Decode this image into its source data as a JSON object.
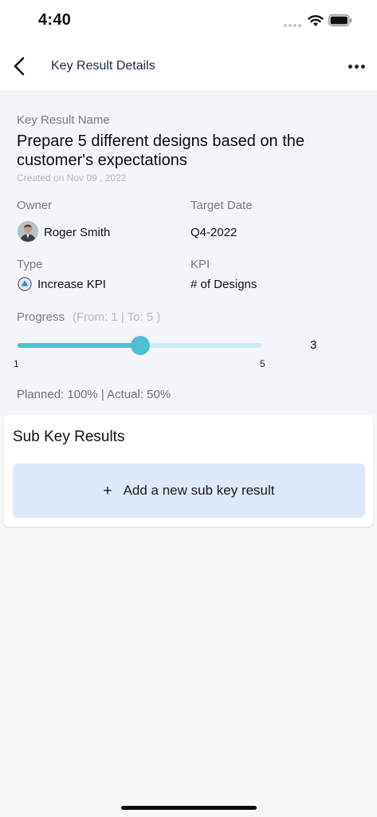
{
  "status": {
    "time": "4:40"
  },
  "nav": {
    "title": "Key Result Details"
  },
  "key_result": {
    "name_label": "Key Result Name",
    "name": "Prepare 5 different designs based on the customer's expectations",
    "created": "Created on Nov 09 , 2022",
    "owner_label": "Owner",
    "owner": "Roger Smith",
    "target_date_label": "Target Date",
    "target_date": "Q4-2022",
    "type_label": "Type",
    "type": "Increase KPI",
    "kpi_label": "KPI",
    "kpi": "# of Designs",
    "progress_label": "Progress",
    "progress_range": "(From: 1  | To: 5 )",
    "progress": {
      "min": 1,
      "max": 5,
      "current": 3,
      "min_label": "1",
      "max_label": "5",
      "current_label": "3"
    },
    "planned_actual": "Planned:  100% | Actual: 50%"
  },
  "sub_key_results": {
    "title": "Sub Key Results",
    "add_label": "Add a new sub key result",
    "add_icon": "+"
  },
  "colors": {
    "accent": "#4cbfd4",
    "track": "#cfeaf3",
    "add_button_bg": "#dde9fb",
    "type_icon": "#2f7de1"
  },
  "icons": {
    "back": "chevron-left-icon",
    "more": "more-horizontal-icon",
    "type": "arrow-up-circle-icon",
    "add": "plus-icon"
  }
}
